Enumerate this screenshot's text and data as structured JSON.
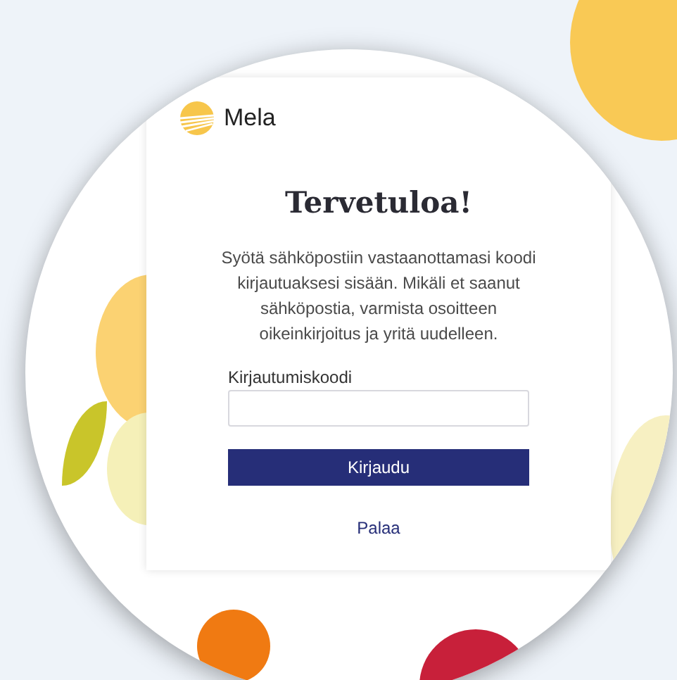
{
  "logo": {
    "text": "Mela"
  },
  "title": "Tervetuloa!",
  "message": "Syötä sähköpostiin vastaanottamasi koodi kirjautuaksesi sisään. Mikäli et saanut sähköpostia, varmista osoitteen oikeinkirjoitus ja yritä uudelleen.",
  "code_field": {
    "label": "Kirjautumiskoodi"
  },
  "submit_button": "Kirjaudu",
  "back_link": "Palaa"
}
